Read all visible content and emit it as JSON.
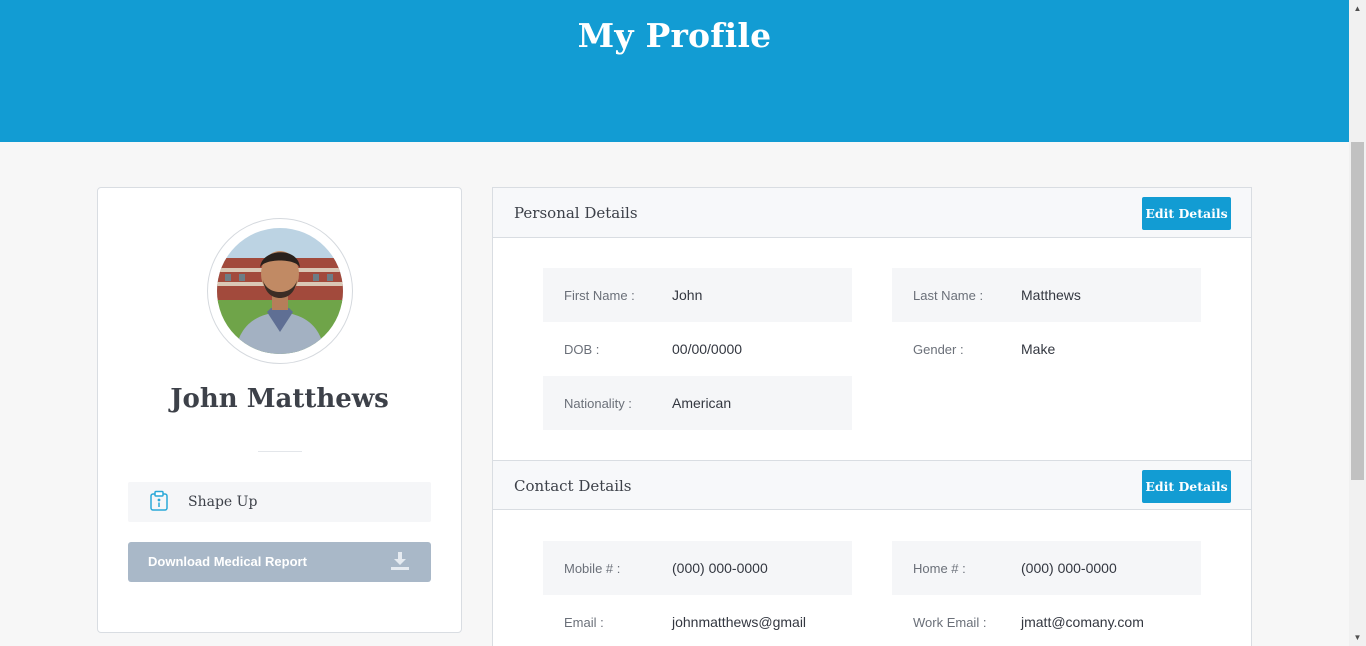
{
  "header": {
    "title": "My Profile"
  },
  "profile": {
    "name": "John Matthews",
    "program": "Shape Up",
    "download_label": "Download Medical Report"
  },
  "personal": {
    "title": "Personal Details",
    "edit_label": "Edit Details",
    "first_name_label": "First Name :",
    "first_name": "John",
    "last_name_label": "Last Name :",
    "last_name": "Matthews",
    "dob_label": "DOB :",
    "dob": "00/00/0000",
    "gender_label": "Gender :",
    "gender": "Make",
    "nationality_label": "Nationality :",
    "nationality": "American"
  },
  "contact": {
    "title": "Contact Details",
    "edit_label": "Edit Details",
    "mobile_label": "Mobile # :",
    "mobile": "(000) 000-0000",
    "home_label": "Home # :",
    "home": "(000) 000-0000",
    "email_label": "Email :",
    "email": "johnmatthews@gmail",
    "work_email_label": "Work Email :",
    "work_email": "jmatt@comany.com"
  },
  "colors": {
    "accent": "#129cd3",
    "download_button": "#a9b8c8",
    "field_bg": "#f5f6f8"
  },
  "icons": {
    "program": "clipboard-icon",
    "download": "download-icon"
  }
}
